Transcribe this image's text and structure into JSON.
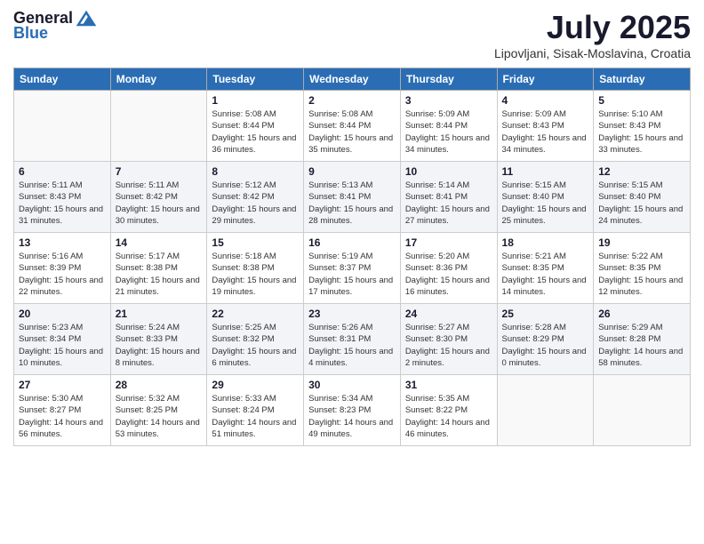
{
  "header": {
    "logo_general": "General",
    "logo_blue": "Blue",
    "month_year": "July 2025",
    "location": "Lipovljani, Sisak-Moslavina, Croatia"
  },
  "days_of_week": [
    "Sunday",
    "Monday",
    "Tuesday",
    "Wednesday",
    "Thursday",
    "Friday",
    "Saturday"
  ],
  "weeks": [
    [
      {
        "num": "",
        "info": ""
      },
      {
        "num": "",
        "info": ""
      },
      {
        "num": "1",
        "info": "Sunrise: 5:08 AM\nSunset: 8:44 PM\nDaylight: 15 hours and 36 minutes."
      },
      {
        "num": "2",
        "info": "Sunrise: 5:08 AM\nSunset: 8:44 PM\nDaylight: 15 hours and 35 minutes."
      },
      {
        "num": "3",
        "info": "Sunrise: 5:09 AM\nSunset: 8:44 PM\nDaylight: 15 hours and 34 minutes."
      },
      {
        "num": "4",
        "info": "Sunrise: 5:09 AM\nSunset: 8:43 PM\nDaylight: 15 hours and 34 minutes."
      },
      {
        "num": "5",
        "info": "Sunrise: 5:10 AM\nSunset: 8:43 PM\nDaylight: 15 hours and 33 minutes."
      }
    ],
    [
      {
        "num": "6",
        "info": "Sunrise: 5:11 AM\nSunset: 8:43 PM\nDaylight: 15 hours and 31 minutes."
      },
      {
        "num": "7",
        "info": "Sunrise: 5:11 AM\nSunset: 8:42 PM\nDaylight: 15 hours and 30 minutes."
      },
      {
        "num": "8",
        "info": "Sunrise: 5:12 AM\nSunset: 8:42 PM\nDaylight: 15 hours and 29 minutes."
      },
      {
        "num": "9",
        "info": "Sunrise: 5:13 AM\nSunset: 8:41 PM\nDaylight: 15 hours and 28 minutes."
      },
      {
        "num": "10",
        "info": "Sunrise: 5:14 AM\nSunset: 8:41 PM\nDaylight: 15 hours and 27 minutes."
      },
      {
        "num": "11",
        "info": "Sunrise: 5:15 AM\nSunset: 8:40 PM\nDaylight: 15 hours and 25 minutes."
      },
      {
        "num": "12",
        "info": "Sunrise: 5:15 AM\nSunset: 8:40 PM\nDaylight: 15 hours and 24 minutes."
      }
    ],
    [
      {
        "num": "13",
        "info": "Sunrise: 5:16 AM\nSunset: 8:39 PM\nDaylight: 15 hours and 22 minutes."
      },
      {
        "num": "14",
        "info": "Sunrise: 5:17 AM\nSunset: 8:38 PM\nDaylight: 15 hours and 21 minutes."
      },
      {
        "num": "15",
        "info": "Sunrise: 5:18 AM\nSunset: 8:38 PM\nDaylight: 15 hours and 19 minutes."
      },
      {
        "num": "16",
        "info": "Sunrise: 5:19 AM\nSunset: 8:37 PM\nDaylight: 15 hours and 17 minutes."
      },
      {
        "num": "17",
        "info": "Sunrise: 5:20 AM\nSunset: 8:36 PM\nDaylight: 15 hours and 16 minutes."
      },
      {
        "num": "18",
        "info": "Sunrise: 5:21 AM\nSunset: 8:35 PM\nDaylight: 15 hours and 14 minutes."
      },
      {
        "num": "19",
        "info": "Sunrise: 5:22 AM\nSunset: 8:35 PM\nDaylight: 15 hours and 12 minutes."
      }
    ],
    [
      {
        "num": "20",
        "info": "Sunrise: 5:23 AM\nSunset: 8:34 PM\nDaylight: 15 hours and 10 minutes."
      },
      {
        "num": "21",
        "info": "Sunrise: 5:24 AM\nSunset: 8:33 PM\nDaylight: 15 hours and 8 minutes."
      },
      {
        "num": "22",
        "info": "Sunrise: 5:25 AM\nSunset: 8:32 PM\nDaylight: 15 hours and 6 minutes."
      },
      {
        "num": "23",
        "info": "Sunrise: 5:26 AM\nSunset: 8:31 PM\nDaylight: 15 hours and 4 minutes."
      },
      {
        "num": "24",
        "info": "Sunrise: 5:27 AM\nSunset: 8:30 PM\nDaylight: 15 hours and 2 minutes."
      },
      {
        "num": "25",
        "info": "Sunrise: 5:28 AM\nSunset: 8:29 PM\nDaylight: 15 hours and 0 minutes."
      },
      {
        "num": "26",
        "info": "Sunrise: 5:29 AM\nSunset: 8:28 PM\nDaylight: 14 hours and 58 minutes."
      }
    ],
    [
      {
        "num": "27",
        "info": "Sunrise: 5:30 AM\nSunset: 8:27 PM\nDaylight: 14 hours and 56 minutes."
      },
      {
        "num": "28",
        "info": "Sunrise: 5:32 AM\nSunset: 8:25 PM\nDaylight: 14 hours and 53 minutes."
      },
      {
        "num": "29",
        "info": "Sunrise: 5:33 AM\nSunset: 8:24 PM\nDaylight: 14 hours and 51 minutes."
      },
      {
        "num": "30",
        "info": "Sunrise: 5:34 AM\nSunset: 8:23 PM\nDaylight: 14 hours and 49 minutes."
      },
      {
        "num": "31",
        "info": "Sunrise: 5:35 AM\nSunset: 8:22 PM\nDaylight: 14 hours and 46 minutes."
      },
      {
        "num": "",
        "info": ""
      },
      {
        "num": "",
        "info": ""
      }
    ]
  ]
}
